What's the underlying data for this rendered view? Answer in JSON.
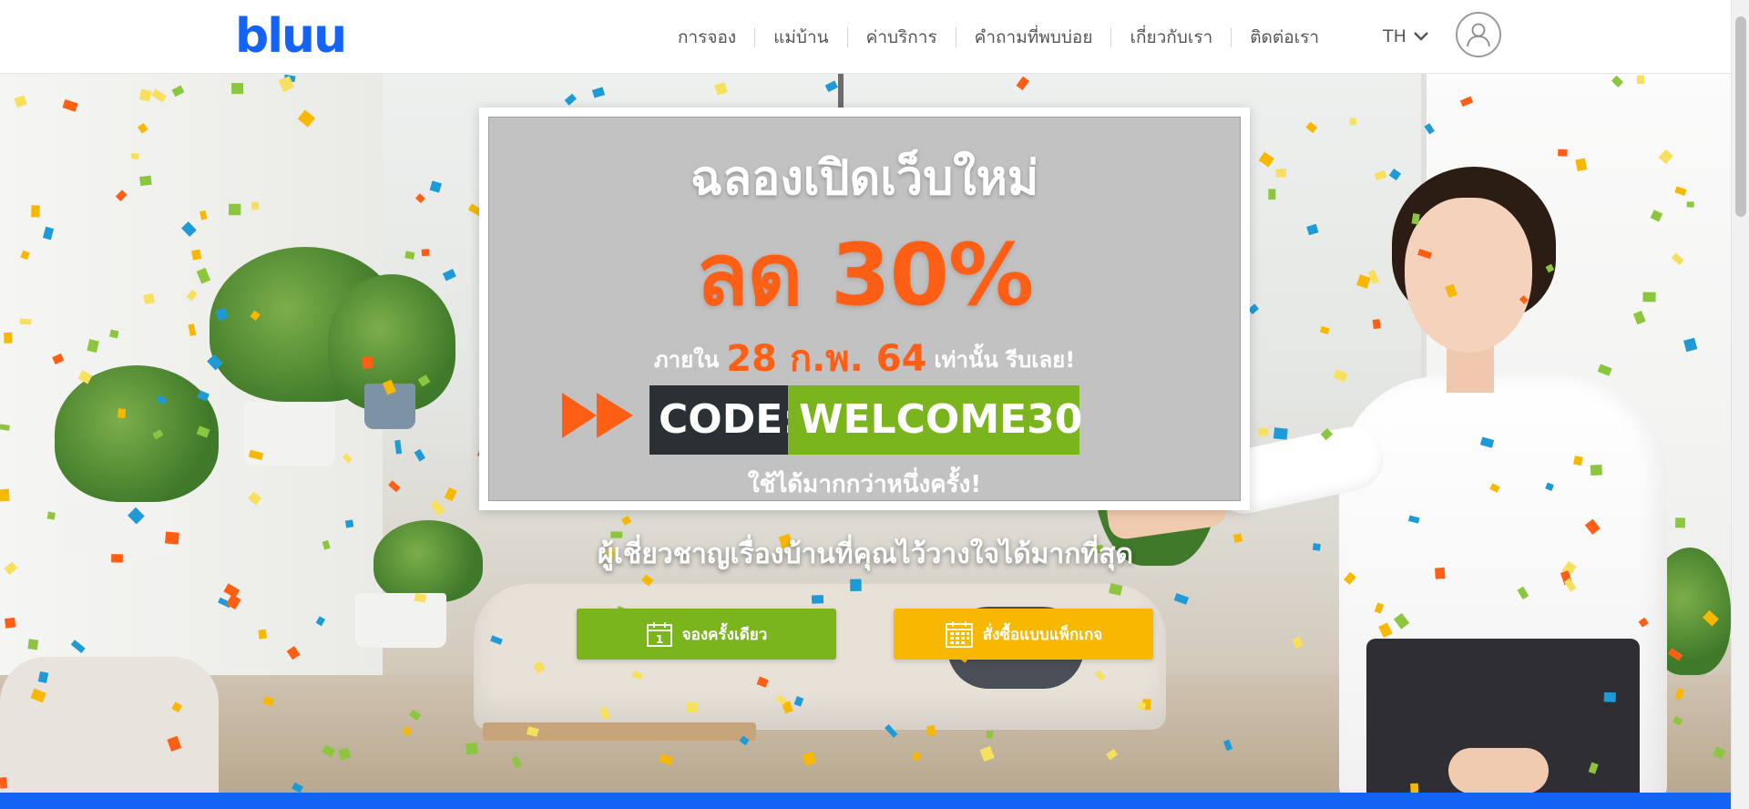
{
  "header": {
    "logo": "bluu",
    "nav": [
      "การจอง",
      "แม่บ้าน",
      "ค่าบริการ",
      "คำถามที่พบบ่อย",
      "เกี่ยวกับเรา",
      "ติดต่อเรา"
    ],
    "lang": "TH",
    "icons": {
      "lang_dropdown": "chevron-down-icon",
      "account": "user-icon"
    }
  },
  "promo": {
    "title": "ฉลองเปิดเว็บใหม่",
    "discount": "ลด 30%",
    "date_prefix": "ภายใน",
    "date": "28 ก.พ. 64",
    "date_suffix": "เท่านั้น รีบเลย!",
    "code_label": "CODE:",
    "code_value": "WELCOME30",
    "note": "ใช้ได้มากกว่าหนึ่งครั้ง!"
  },
  "hero": {
    "tagline": "ผู้เชี่ยวชาญเรื่องบ้านที่คุณไว้วางใจได้มากที่สุด",
    "buttons": {
      "book_once": "จองครั้งเดียว",
      "book_once_icon_day": "1",
      "package": "สั่งซื้อแบบแพ็กเกจ"
    }
  },
  "colors": {
    "brand_blue": "#1463f5",
    "green": "#7ab51d",
    "orange": "#ff5f14",
    "yellow": "#f9b800",
    "dark": "#2b3035"
  }
}
